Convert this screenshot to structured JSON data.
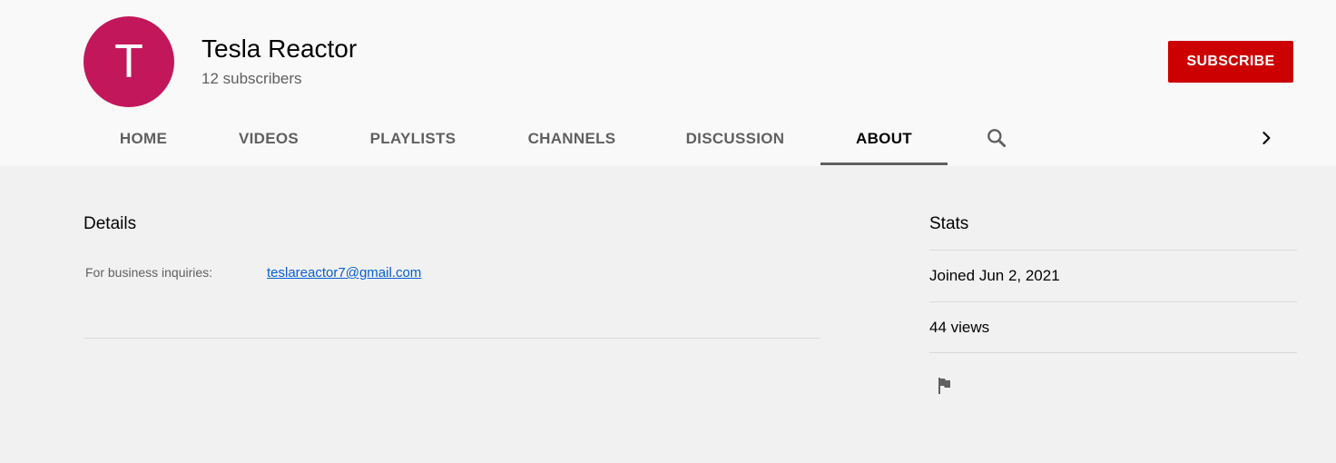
{
  "channel": {
    "avatar_letter": "T",
    "avatar_color": "#c2185b",
    "name": "Tesla Reactor",
    "subscribers": "12 subscribers"
  },
  "subscribe_label": "SUBSCRIBE",
  "subscribe_color": "#cc0000",
  "tabs": [
    {
      "label": "HOME"
    },
    {
      "label": "VIDEOS"
    },
    {
      "label": "PLAYLISTS"
    },
    {
      "label": "CHANNELS"
    },
    {
      "label": "DISCUSSION"
    },
    {
      "label": "ABOUT",
      "active": true
    }
  ],
  "icons": {
    "search": "search-icon",
    "next": "chevron-right-icon",
    "report": "flag-icon"
  },
  "details": {
    "title": "Details",
    "business_label": "For business inquiries:",
    "email": "teslareactor7@gmail.com"
  },
  "stats": {
    "title": "Stats",
    "joined": "Joined Jun 2, 2021",
    "views": "44 views"
  }
}
